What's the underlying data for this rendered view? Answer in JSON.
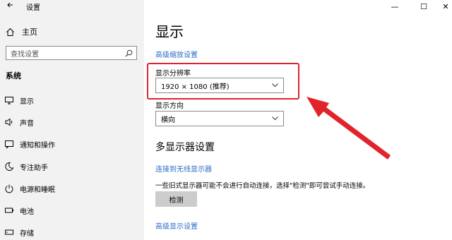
{
  "window": {
    "title": "设置",
    "minimize_glyph": "—",
    "maximize_glyph": "☐",
    "close_glyph": "✕"
  },
  "sidebar": {
    "home_label": "主页",
    "search_placeholder": "查找设置",
    "section_title": "系统",
    "items": [
      {
        "label": "显示",
        "icon": "monitor-icon"
      },
      {
        "label": "声音",
        "icon": "speaker-icon"
      },
      {
        "label": "通知和操作",
        "icon": "notification-icon"
      },
      {
        "label": "专注助手",
        "icon": "moon-icon"
      },
      {
        "label": "电源和睡眠",
        "icon": "power-icon"
      },
      {
        "label": "电池",
        "icon": "battery-icon"
      },
      {
        "label": "存储",
        "icon": "storage-icon"
      }
    ]
  },
  "main": {
    "title": "显示",
    "advanced_scaling_link": "高级缩放设置",
    "resolution_label": "显示分辨率",
    "resolution_value": "1920 × 1080 (推荐)",
    "orientation_label": "显示方向",
    "orientation_value": "横向",
    "multi_display_heading": "多显示器设置",
    "wireless_link": "连接到无线显示器",
    "detect_description": "一些旧式显示器可能不会进行自动连接，选择\"检测\"即可尝试手动连接。",
    "detect_button": "检测",
    "advanced_display_link": "高级显示设置"
  },
  "annotation": {
    "highlight_color": "#e0242c"
  }
}
